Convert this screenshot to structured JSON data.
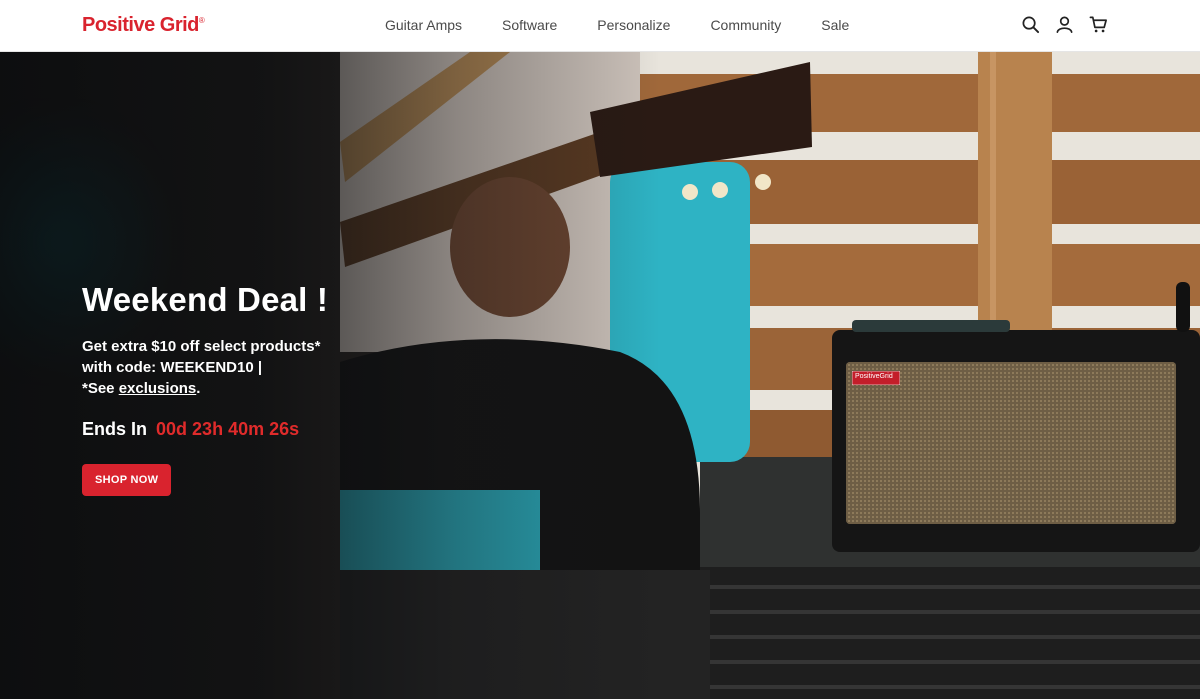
{
  "brand": {
    "logo_text": "Positive Grid",
    "logo_mark": "®",
    "color": "#d9232e"
  },
  "nav": {
    "items": [
      "Guitar Amps",
      "Software",
      "Personalize",
      "Community",
      "Sale"
    ]
  },
  "icons": {
    "search": "search-icon",
    "account": "user-icon",
    "cart": "cart-icon"
  },
  "hero": {
    "title": "Weekend Deal !",
    "line1": "Get extra $10 off select products*",
    "line2": "with code: WEEKEND10 |",
    "line3_prefix": "*See ",
    "line3_link": "exclusions",
    "line3_suffix": ".",
    "countdown_label": "Ends In",
    "countdown_value": "00d 23h 40m 26s",
    "cta_label": "SHOP NOW",
    "amp_badge": "PositiveGrid",
    "accent_color": "#e02b2b"
  }
}
